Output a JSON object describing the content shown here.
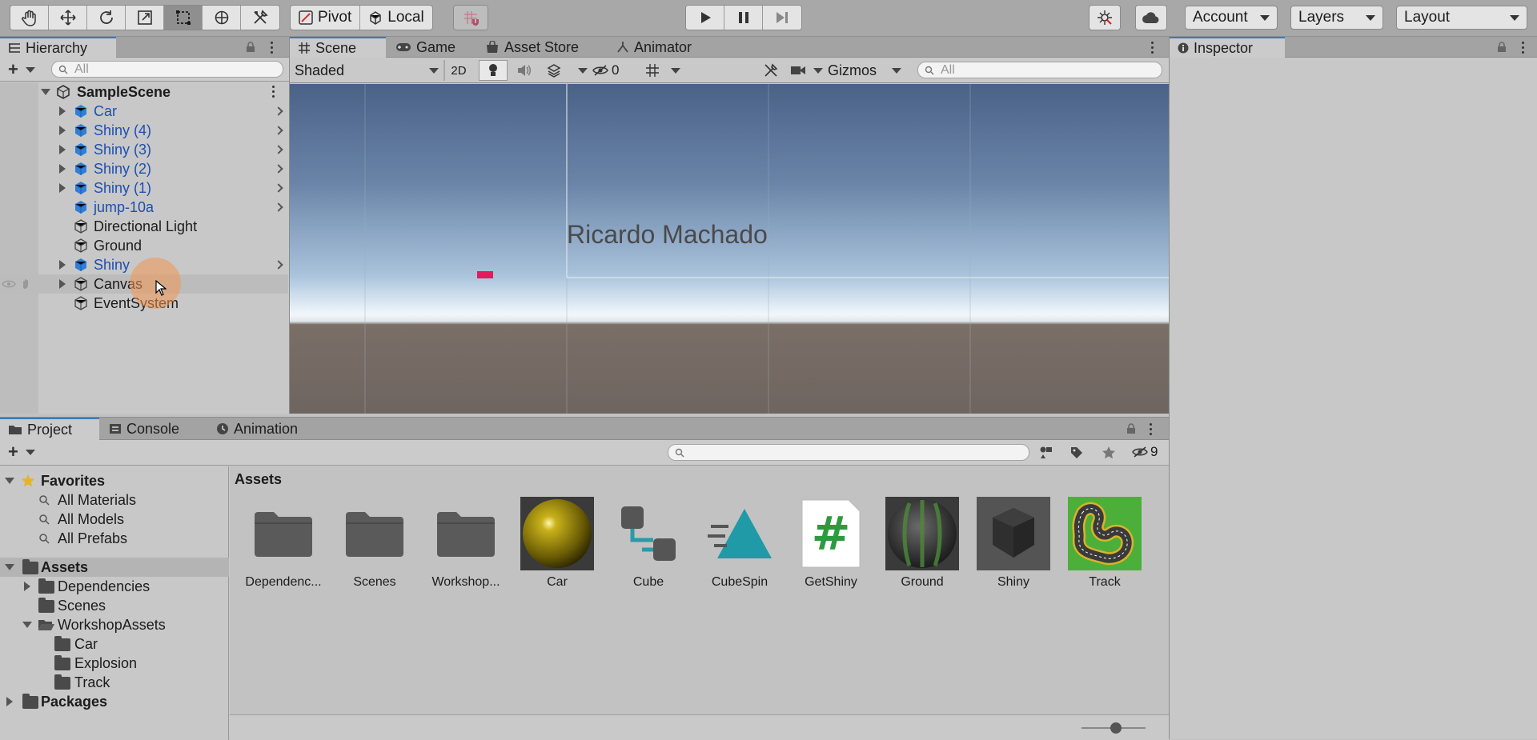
{
  "toolbar": {
    "pivot": "Pivot",
    "local": "Local",
    "account": "Account",
    "layers": "Layers",
    "layout": "Layout"
  },
  "hierarchy": {
    "tab": "Hierarchy",
    "search_placeholder": "All",
    "scene_name": "SampleScene",
    "items": [
      {
        "label": "Car",
        "prefab": true,
        "expandable": true
      },
      {
        "label": "Shiny (4)",
        "prefab": true,
        "expandable": true
      },
      {
        "label": "Shiny (3)",
        "prefab": true,
        "expandable": true
      },
      {
        "label": "Shiny (2)",
        "prefab": true,
        "expandable": true
      },
      {
        "label": "Shiny (1)",
        "prefab": true,
        "expandable": true
      },
      {
        "label": "jump-10a",
        "prefab": true,
        "expandable": false
      },
      {
        "label": "Directional Light",
        "prefab": false,
        "expandable": false
      },
      {
        "label": "Ground",
        "prefab": false,
        "expandable": false
      },
      {
        "label": "Shiny",
        "prefab": true,
        "expandable": true
      },
      {
        "label": "Canvas",
        "prefab": false,
        "expandable": true
      },
      {
        "label": "EventSystem",
        "prefab": false,
        "expandable": false
      }
    ]
  },
  "scene": {
    "tabs": [
      "Scene",
      "Game",
      "Asset Store",
      "Animator"
    ],
    "shading": "Shaded",
    "mode_2d": "2D",
    "hidden_count": "0",
    "gizmos": "Gizmos",
    "search_placeholder": "All",
    "overlay_text": "Ricardo Machado"
  },
  "inspector": {
    "tab": "Inspector"
  },
  "project": {
    "tabs": [
      "Project",
      "Console",
      "Animation"
    ],
    "hidden_count": "9",
    "breadcrumb": "Assets",
    "favorites_label": "Favorites",
    "favorites": [
      "All Materials",
      "All Models",
      "All Prefabs"
    ],
    "assets_label": "Assets",
    "asset_tree": {
      "dependencies": "Dependencies",
      "scenes": "Scenes",
      "workshop_assets": "WorkshopAssets",
      "workshop_children": [
        "Car",
        "Explosion",
        "Track"
      ]
    },
    "packages_label": "Packages",
    "grid": [
      {
        "name": "Dependenc...",
        "kind": "folder"
      },
      {
        "name": "Scenes",
        "kind": "folder"
      },
      {
        "name": "Workshop...",
        "kind": "folder"
      },
      {
        "name": "Car",
        "kind": "material-yellow"
      },
      {
        "name": "Cube",
        "kind": "shadergraph"
      },
      {
        "name": "CubeSpin",
        "kind": "animation"
      },
      {
        "name": "GetShiny",
        "kind": "script"
      },
      {
        "name": "Ground",
        "kind": "material-ground"
      },
      {
        "name": "Shiny",
        "kind": "prefab-cube"
      },
      {
        "name": "Track",
        "kind": "texture-track"
      }
    ]
  }
}
